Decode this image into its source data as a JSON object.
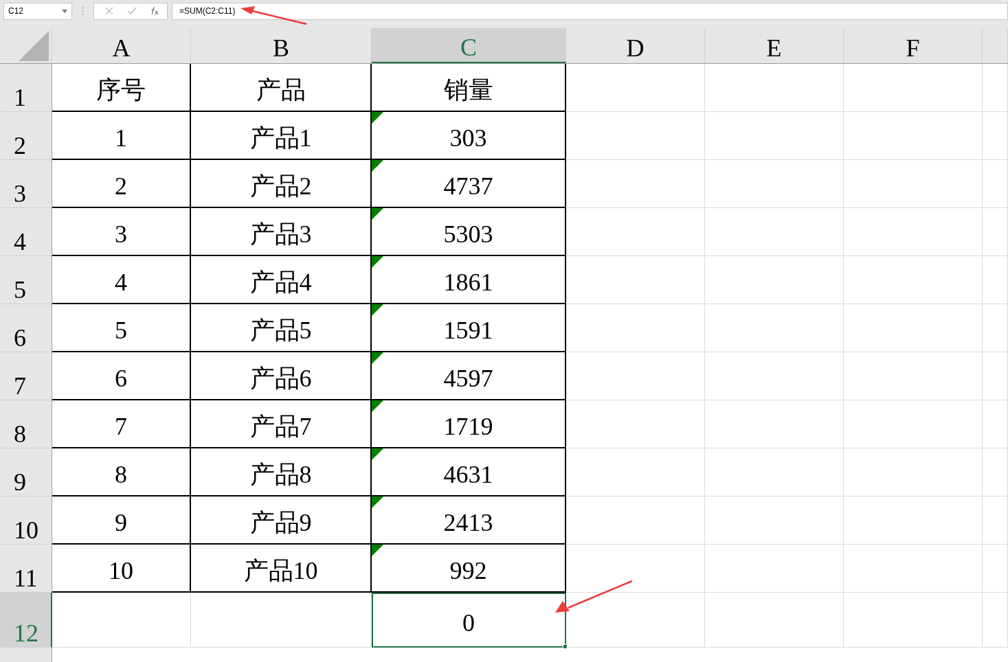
{
  "name_box": {
    "value": "C12"
  },
  "formula_bar": {
    "value": "=SUM(C2:C11)"
  },
  "columns": [
    {
      "label": "A",
      "selected": false
    },
    {
      "label": "B",
      "selected": false
    },
    {
      "label": "C",
      "selected": true
    },
    {
      "label": "D",
      "selected": false
    },
    {
      "label": "E",
      "selected": false
    },
    {
      "label": "F",
      "selected": false
    }
  ],
  "rows": [
    {
      "label": "1",
      "selected": false,
      "cells": [
        {
          "value": "序号",
          "bordered": true,
          "text_number": false,
          "selected": false
        },
        {
          "value": "产品",
          "bordered": true,
          "text_number": false,
          "selected": false
        },
        {
          "value": "销量",
          "bordered": true,
          "text_number": false,
          "selected": false
        }
      ]
    },
    {
      "label": "2",
      "selected": false,
      "cells": [
        {
          "value": "1",
          "bordered": true,
          "text_number": false,
          "selected": false
        },
        {
          "value": "产品1",
          "bordered": true,
          "text_number": false,
          "selected": false
        },
        {
          "value": "303",
          "bordered": true,
          "text_number": true,
          "selected": false
        }
      ]
    },
    {
      "label": "3",
      "selected": false,
      "cells": [
        {
          "value": "2",
          "bordered": true,
          "text_number": false,
          "selected": false
        },
        {
          "value": "产品2",
          "bordered": true,
          "text_number": false,
          "selected": false
        },
        {
          "value": "4737",
          "bordered": true,
          "text_number": true,
          "selected": false
        }
      ]
    },
    {
      "label": "4",
      "selected": false,
      "cells": [
        {
          "value": "3",
          "bordered": true,
          "text_number": false,
          "selected": false
        },
        {
          "value": "产品3",
          "bordered": true,
          "text_number": false,
          "selected": false
        },
        {
          "value": "5303",
          "bordered": true,
          "text_number": true,
          "selected": false
        }
      ]
    },
    {
      "label": "5",
      "selected": false,
      "cells": [
        {
          "value": "4",
          "bordered": true,
          "text_number": false,
          "selected": false
        },
        {
          "value": "产品4",
          "bordered": true,
          "text_number": false,
          "selected": false
        },
        {
          "value": "1861",
          "bordered": true,
          "text_number": true,
          "selected": false
        }
      ]
    },
    {
      "label": "6",
      "selected": false,
      "cells": [
        {
          "value": "5",
          "bordered": true,
          "text_number": false,
          "selected": false
        },
        {
          "value": "产品5",
          "bordered": true,
          "text_number": false,
          "selected": false
        },
        {
          "value": "1591",
          "bordered": true,
          "text_number": true,
          "selected": false
        }
      ]
    },
    {
      "label": "7",
      "selected": false,
      "cells": [
        {
          "value": "6",
          "bordered": true,
          "text_number": false,
          "selected": false
        },
        {
          "value": "产品6",
          "bordered": true,
          "text_number": false,
          "selected": false
        },
        {
          "value": "4597",
          "bordered": true,
          "text_number": true,
          "selected": false
        }
      ]
    },
    {
      "label": "8",
      "selected": false,
      "cells": [
        {
          "value": "7",
          "bordered": true,
          "text_number": false,
          "selected": false
        },
        {
          "value": "产品7",
          "bordered": true,
          "text_number": false,
          "selected": false
        },
        {
          "value": "1719",
          "bordered": true,
          "text_number": true,
          "selected": false
        }
      ]
    },
    {
      "label": "9",
      "selected": false,
      "cells": [
        {
          "value": "8",
          "bordered": true,
          "text_number": false,
          "selected": false
        },
        {
          "value": "产品8",
          "bordered": true,
          "text_number": false,
          "selected": false
        },
        {
          "value": "4631",
          "bordered": true,
          "text_number": true,
          "selected": false
        }
      ]
    },
    {
      "label": "10",
      "selected": false,
      "cells": [
        {
          "value": "9",
          "bordered": true,
          "text_number": false,
          "selected": false
        },
        {
          "value": "产品9",
          "bordered": true,
          "text_number": false,
          "selected": false
        },
        {
          "value": "2413",
          "bordered": true,
          "text_number": true,
          "selected": false
        }
      ]
    },
    {
      "label": "11",
      "selected": false,
      "cells": [
        {
          "value": "10",
          "bordered": true,
          "text_number": false,
          "selected": false
        },
        {
          "value": "产品10",
          "bordered": true,
          "text_number": false,
          "selected": false
        },
        {
          "value": "992",
          "bordered": true,
          "text_number": true,
          "selected": false
        }
      ]
    },
    {
      "label": "12",
      "selected": true,
      "cells": [
        {
          "bordered": false,
          "text_number": false,
          "selected": false
        },
        {
          "bordered": false,
          "text_number": false,
          "selected": false
        },
        {
          "value": "0",
          "bordered": false,
          "text_number": false,
          "selected": true
        }
      ]
    }
  ]
}
